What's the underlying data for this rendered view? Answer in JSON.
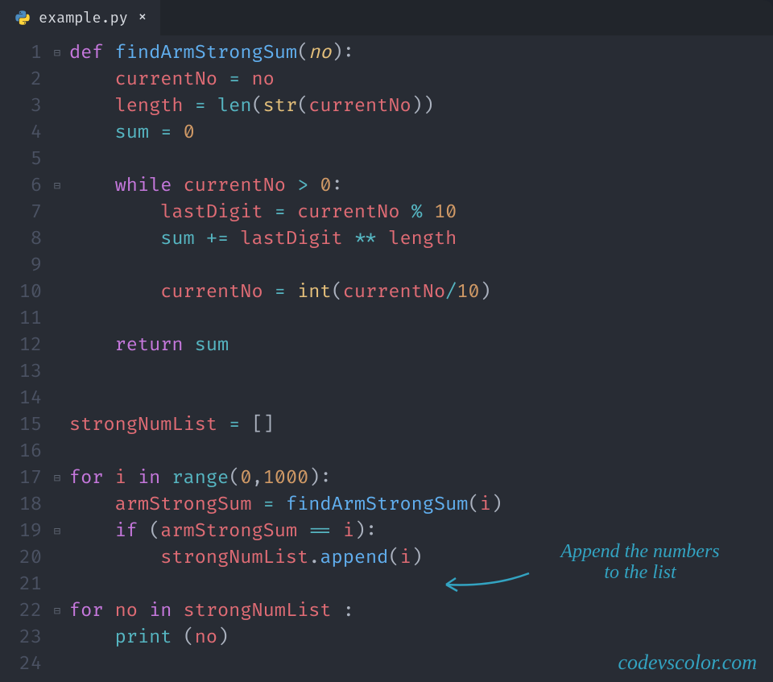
{
  "tab": {
    "filename": "example.py",
    "language_icon": "python-icon"
  },
  "code": {
    "line_count": 24,
    "fold_markers": {
      "1": "−",
      "6": "−",
      "17": "−",
      "19": "−",
      "22": "−"
    },
    "lines": [
      {
        "n": 1,
        "tokens": [
          [
            "kw",
            "def "
          ],
          [
            "fn",
            "findArmStrongSum"
          ],
          [
            "punc",
            "("
          ],
          [
            "param",
            "no"
          ],
          [
            "punc",
            ")"
          ],
          [
            "punc",
            ":"
          ]
        ]
      },
      {
        "n": 2,
        "indent": 1,
        "tokens": [
          [
            "id",
            "currentNo"
          ],
          [
            "op",
            " = "
          ],
          [
            "id",
            "no"
          ]
        ]
      },
      {
        "n": 3,
        "indent": 1,
        "tokens": [
          [
            "id",
            "length"
          ],
          [
            "op",
            " = "
          ],
          [
            "bi",
            "len"
          ],
          [
            "punc",
            "("
          ],
          [
            "biy",
            "str"
          ],
          [
            "punc",
            "("
          ],
          [
            "id",
            "currentNo"
          ],
          [
            "punc",
            "))"
          ]
        ]
      },
      {
        "n": 4,
        "indent": 1,
        "tokens": [
          [
            "bi",
            "sum"
          ],
          [
            "op",
            " = "
          ],
          [
            "num",
            "0"
          ]
        ]
      },
      {
        "n": 5,
        "indent": 0,
        "tokens": []
      },
      {
        "n": 6,
        "indent": 1,
        "tokens": [
          [
            "kw",
            "while"
          ],
          [
            "punc",
            " "
          ],
          [
            "id",
            "currentNo"
          ],
          [
            "op",
            " > "
          ],
          [
            "num",
            "0"
          ],
          [
            "punc",
            ":"
          ]
        ]
      },
      {
        "n": 7,
        "indent": 2,
        "tokens": [
          [
            "id",
            "lastDigit"
          ],
          [
            "op",
            " = "
          ],
          [
            "id",
            "currentNo"
          ],
          [
            "op",
            " % "
          ],
          [
            "num",
            "10"
          ]
        ]
      },
      {
        "n": 8,
        "indent": 2,
        "tokens": [
          [
            "bi",
            "sum"
          ],
          [
            "op",
            " += "
          ],
          [
            "id",
            "lastDigit"
          ],
          [
            "op",
            " ** "
          ],
          [
            "id",
            "length"
          ]
        ]
      },
      {
        "n": 9,
        "indent": 0,
        "tokens": []
      },
      {
        "n": 10,
        "indent": 2,
        "tokens": [
          [
            "id",
            "currentNo"
          ],
          [
            "op",
            " = "
          ],
          [
            "biy",
            "int"
          ],
          [
            "punc",
            "("
          ],
          [
            "id",
            "currentNo"
          ],
          [
            "op",
            "/"
          ],
          [
            "num",
            "10"
          ],
          [
            "punc",
            ")"
          ]
        ]
      },
      {
        "n": 11,
        "indent": 0,
        "tokens": []
      },
      {
        "n": 12,
        "indent": 1,
        "tokens": [
          [
            "kw",
            "return"
          ],
          [
            "punc",
            " "
          ],
          [
            "bi",
            "sum"
          ]
        ]
      },
      {
        "n": 13,
        "indent": 0,
        "tokens": []
      },
      {
        "n": 14,
        "indent": 0,
        "tokens": []
      },
      {
        "n": 15,
        "indent": 0,
        "tokens": [
          [
            "id",
            "strongNumList"
          ],
          [
            "op",
            " = "
          ],
          [
            "punc",
            "[]"
          ]
        ]
      },
      {
        "n": 16,
        "indent": 0,
        "tokens": []
      },
      {
        "n": 17,
        "indent": 0,
        "tokens": [
          [
            "kw",
            "for"
          ],
          [
            "punc",
            " "
          ],
          [
            "id",
            "i"
          ],
          [
            "punc",
            " "
          ],
          [
            "kw",
            "in"
          ],
          [
            "punc",
            " "
          ],
          [
            "bi",
            "range"
          ],
          [
            "punc",
            "("
          ],
          [
            "num",
            "0"
          ],
          [
            "punc",
            ","
          ],
          [
            "num",
            "1000"
          ],
          [
            "punc",
            ")"
          ],
          [
            "punc",
            ":"
          ]
        ]
      },
      {
        "n": 18,
        "indent": 1,
        "tokens": [
          [
            "id",
            "armStrongSum"
          ],
          [
            "op",
            " = "
          ],
          [
            "fn",
            "findArmStrongSum"
          ],
          [
            "punc",
            "("
          ],
          [
            "id",
            "i"
          ],
          [
            "punc",
            ")"
          ]
        ]
      },
      {
        "n": 19,
        "indent": 1,
        "tokens": [
          [
            "kw",
            "if"
          ],
          [
            "punc",
            " ("
          ],
          [
            "id",
            "armStrongSum"
          ],
          [
            "op",
            " == "
          ],
          [
            "id",
            "i"
          ],
          [
            "punc",
            ")"
          ],
          [
            "punc",
            ":"
          ]
        ]
      },
      {
        "n": 20,
        "indent": 2,
        "tokens": [
          [
            "id",
            "strongNumList"
          ],
          [
            "punc",
            "."
          ],
          [
            "fn",
            "append"
          ],
          [
            "punc",
            "("
          ],
          [
            "id",
            "i"
          ],
          [
            "punc",
            ")"
          ]
        ]
      },
      {
        "n": 21,
        "indent": 0,
        "tokens": []
      },
      {
        "n": 22,
        "indent": 0,
        "tokens": [
          [
            "kw",
            "for"
          ],
          [
            "punc",
            " "
          ],
          [
            "id",
            "no"
          ],
          [
            "punc",
            " "
          ],
          [
            "kw",
            "in"
          ],
          [
            "punc",
            " "
          ],
          [
            "id",
            "strongNumList"
          ],
          [
            "punc",
            " :"
          ]
        ]
      },
      {
        "n": 23,
        "indent": 1,
        "tokens": [
          [
            "bi",
            "print"
          ],
          [
            "punc",
            " ("
          ],
          [
            "id",
            "no"
          ],
          [
            "punc",
            ")"
          ]
        ]
      },
      {
        "n": 24,
        "indent": 0,
        "tokens": []
      }
    ]
  },
  "annotation": {
    "line1": "Append the numbers",
    "line2": "to the list"
  },
  "watermark": "codevscolor.com"
}
